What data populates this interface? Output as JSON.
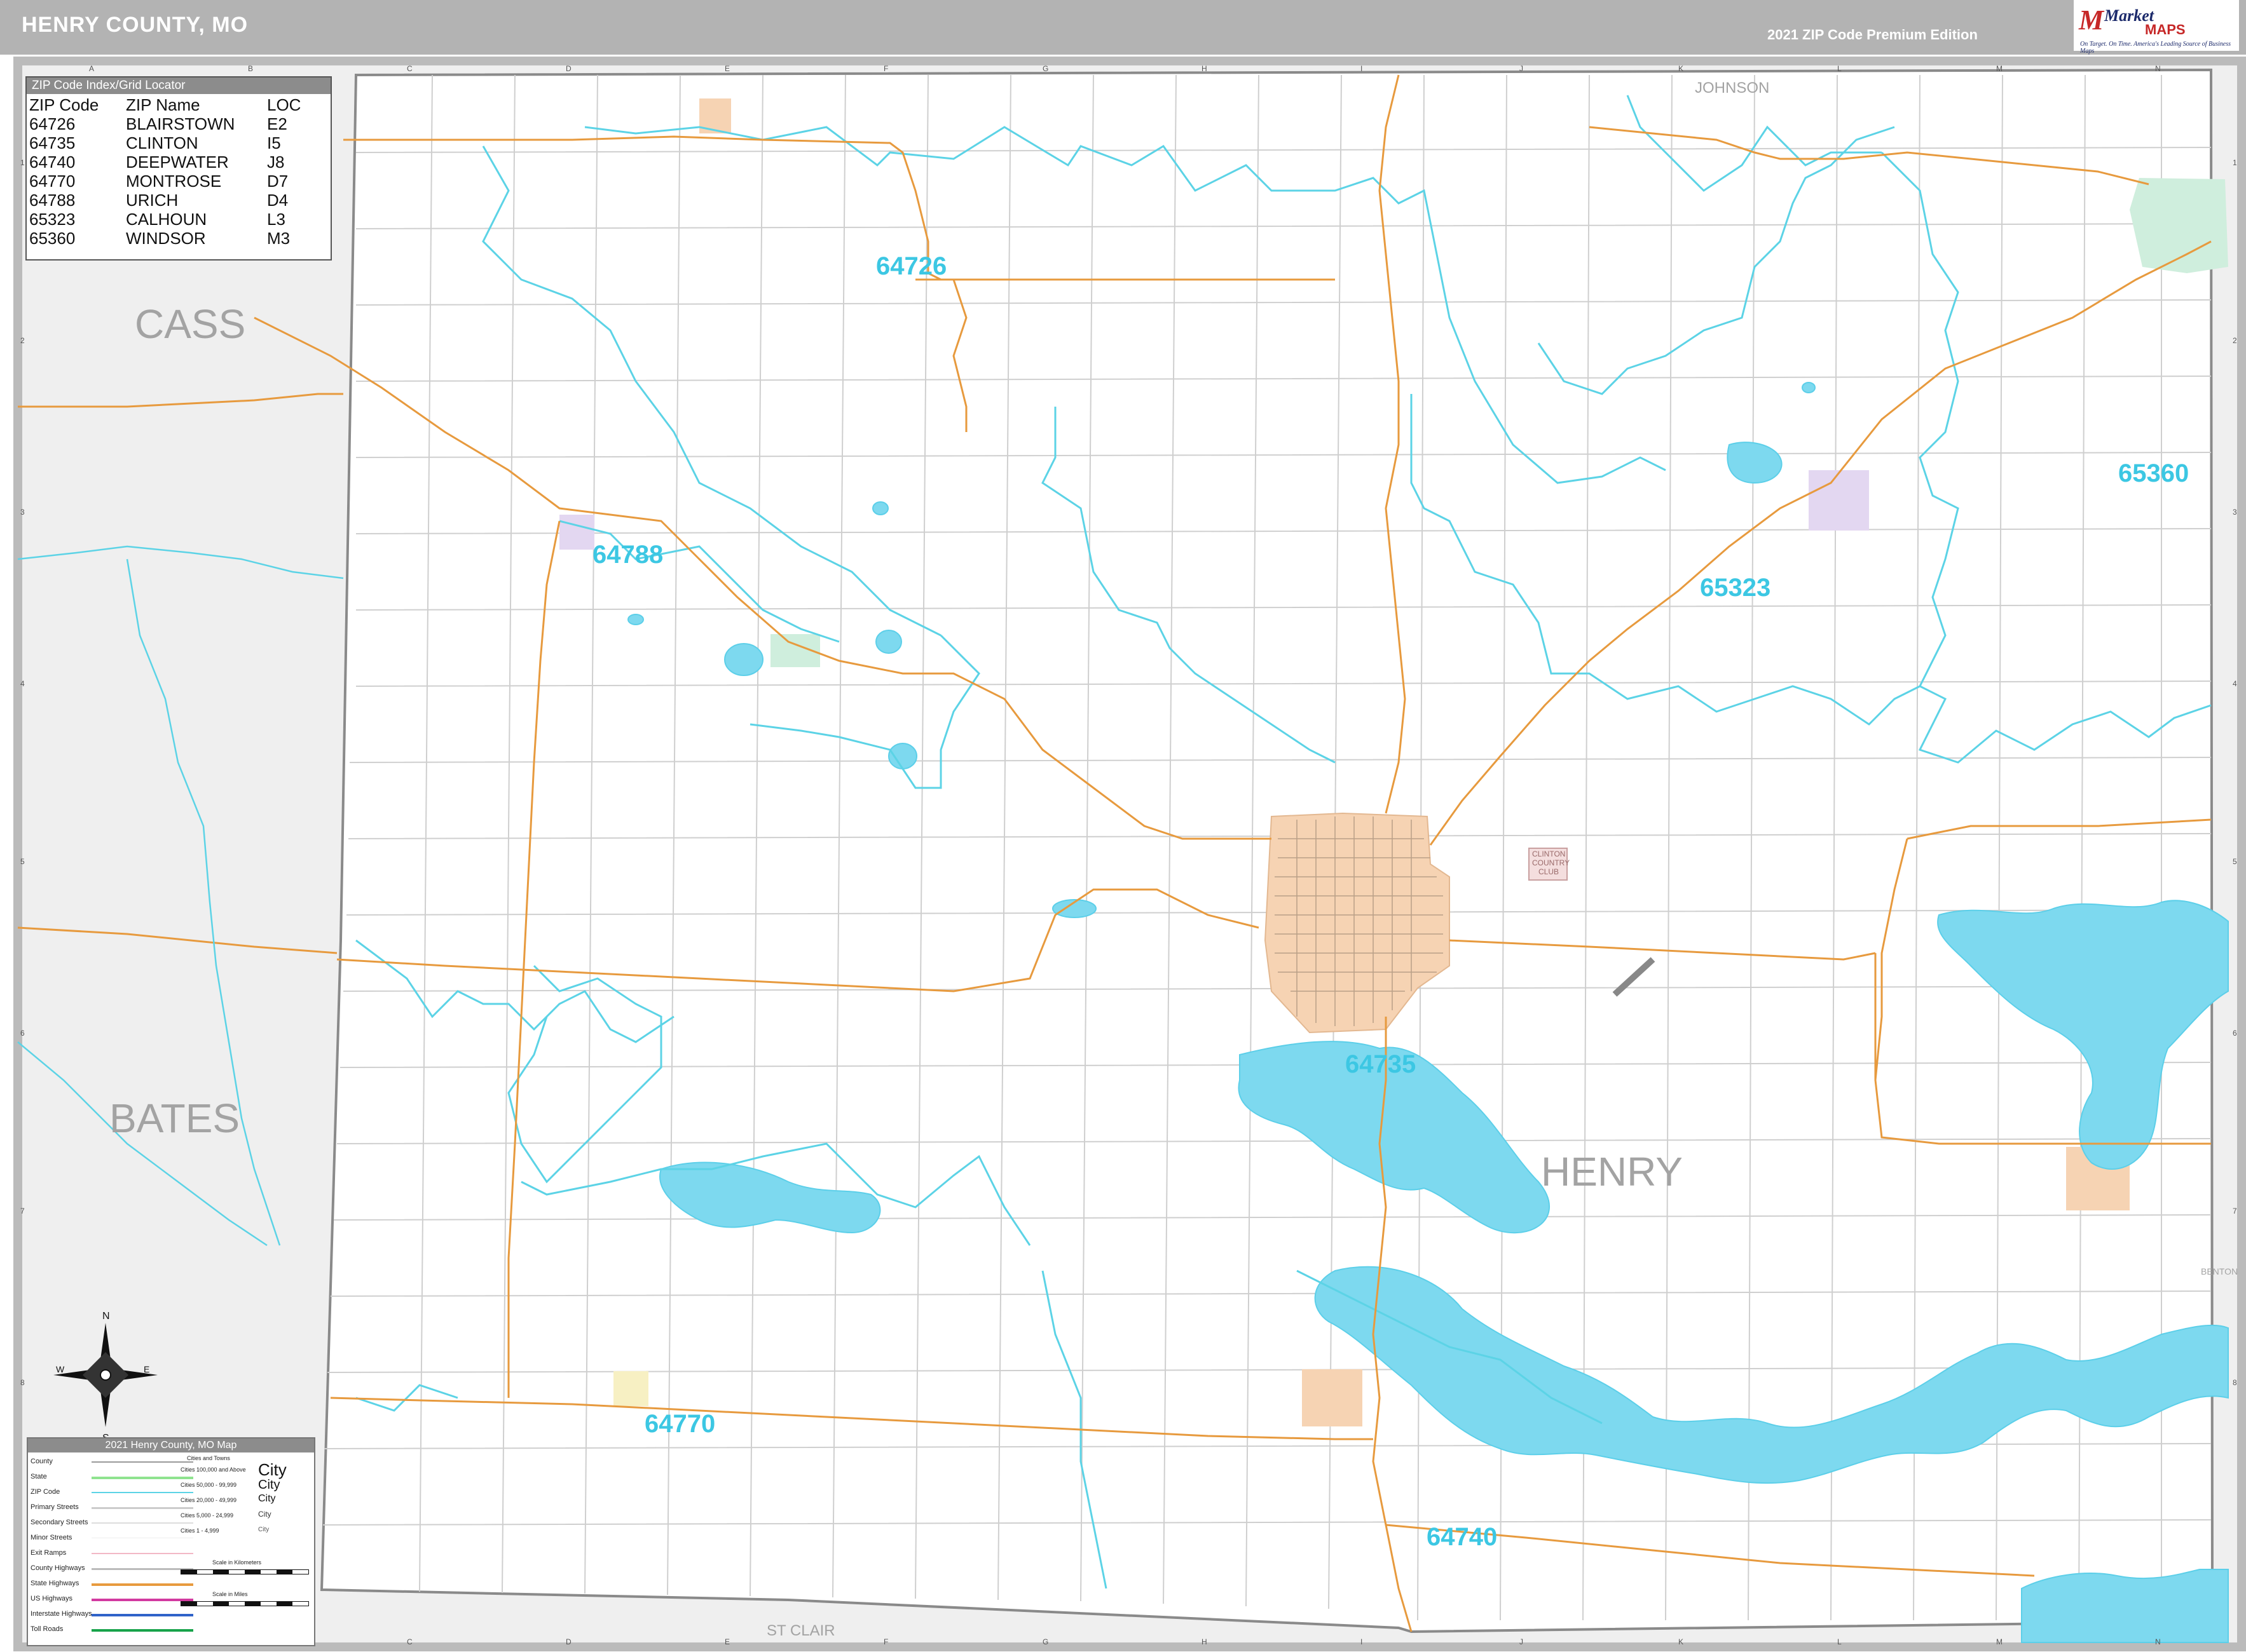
{
  "header": {
    "title": "HENRY COUNTY, MO",
    "edition": "2021 ZIP Code Premium Edition",
    "logo": {
      "brand_market": "Market",
      "brand_maps": "MAPS",
      "tagline": "On Target. On Time.",
      "tagline2": "America's Leading Source of Business Maps"
    }
  },
  "colors": {
    "header_bg": "#b3b3b3",
    "zip_boundary": "#5cd3e6",
    "zip_label": "#3cc7e3",
    "water": "#7dd9ef",
    "highway": "#e79a3e",
    "city_clinton": "#f6d3b3",
    "city_urich": "#e3d7f1",
    "city_windsor": "#cfeedd",
    "outside_county": "#efefef",
    "county_name": "#a3a3a3"
  },
  "grid": {
    "columns": [
      "A",
      "B",
      "C",
      "D",
      "E",
      "F",
      "G",
      "H",
      "I",
      "J",
      "K",
      "L",
      "M",
      "N"
    ],
    "rows": [
      "1",
      "2",
      "3",
      "4",
      "5",
      "6",
      "7",
      "8"
    ]
  },
  "counties": {
    "cass": "CASS",
    "bates": "BATES",
    "henry": "HENRY",
    "johnson": "JOHNSON",
    "st_clair": "ST CLAIR",
    "benton": "BENTON"
  },
  "zip_labels": {
    "z64726": "64726",
    "z64788": "64788",
    "z65323": "65323",
    "z65360": "65360",
    "z64735": "64735",
    "z64770": "64770",
    "z64740": "64740"
  },
  "places": {
    "clinton_country_club_1": "CLINTON",
    "clinton_country_club_2": "COUNTRY",
    "clinton_country_club_3": "CLUB"
  },
  "zip_index": {
    "title": "ZIP Code Index/Grid Locator",
    "headers": [
      "ZIP Code",
      "ZIP Name",
      "LOC"
    ],
    "rows": [
      [
        "64726",
        "BLAIRSTOWN",
        "E2"
      ],
      [
        "64735",
        "CLINTON",
        "I5"
      ],
      [
        "64740",
        "DEEPWATER",
        "J8"
      ],
      [
        "64770",
        "MONTROSE",
        "D7"
      ],
      [
        "64788",
        "URICH",
        "D4"
      ],
      [
        "65323",
        "CALHOUN",
        "L3"
      ],
      [
        "65360",
        "WINDSOR",
        "M3"
      ]
    ]
  },
  "legend": {
    "title": "2021 Henry County, MO Map",
    "items": [
      "County",
      "State",
      "ZIP Code",
      "Primary Streets",
      "Secondary Streets",
      "Minor Streets",
      "Exit Ramps",
      "County Highways",
      "State Highways",
      "US Highways",
      "Interstate Highways",
      "Toll Roads"
    ],
    "cities_header": "Cities and Towns",
    "city_sizes": [
      "Cities 100,000 and Above",
      "Cities 50,000 - 99,999",
      "Cities 20,000 - 49,999",
      "Cities 5,000 - 24,999",
      "Cities 1 - 4,999"
    ],
    "city_samples": [
      "City",
      "City",
      "City",
      "City",
      "City"
    ],
    "scale_km": "Scale in Kilometers",
    "scale_mi": "Scale in Miles"
  },
  "compass": {
    "n": "N",
    "s": "S",
    "e": "E",
    "w": "W"
  }
}
